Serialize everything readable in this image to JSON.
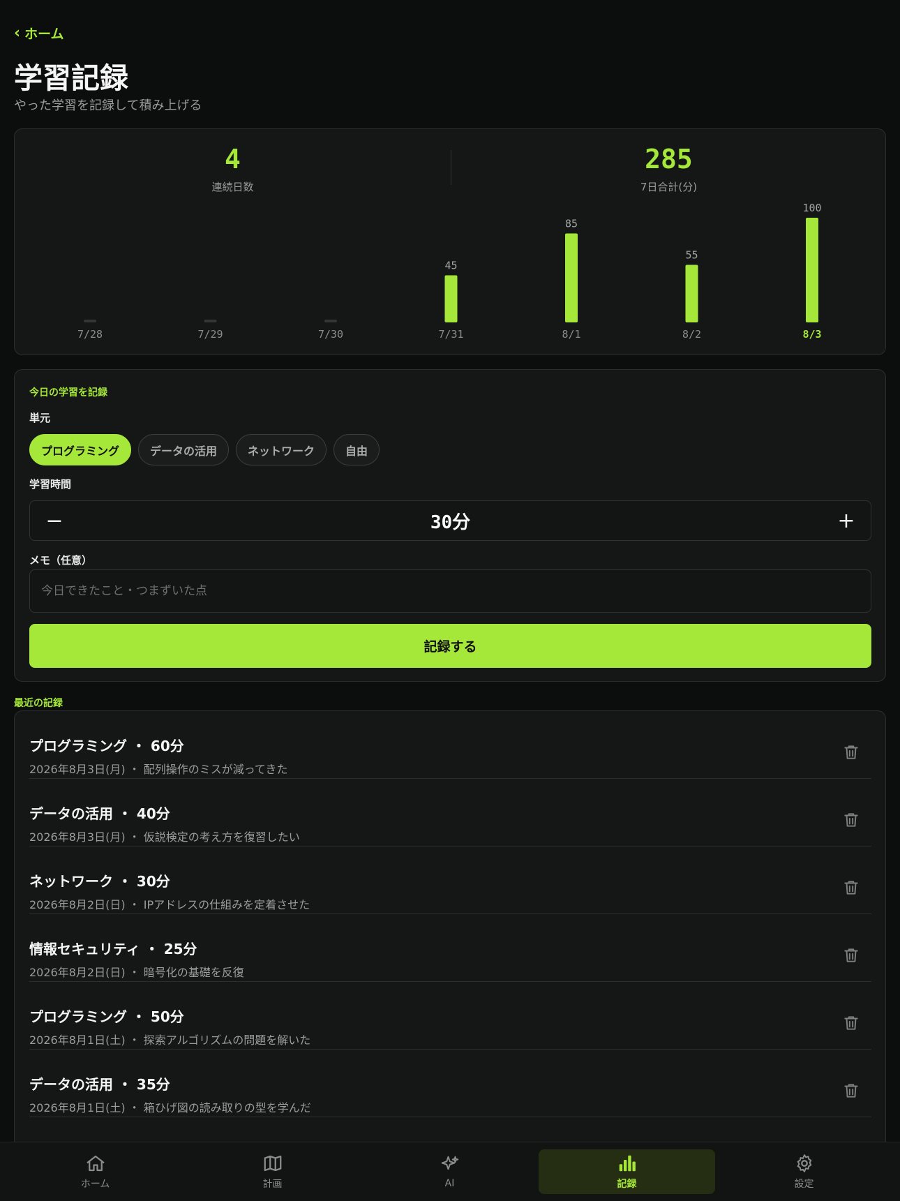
{
  "header": {
    "back_label": "ホーム",
    "title": "学習記録",
    "subtitle": "やった学習を記録して積み上げる"
  },
  "stats": {
    "streak_value": "4",
    "streak_label": "連続日数",
    "total_value": "285",
    "total_label": "7日合計(分)"
  },
  "chart_data": {
    "type": "bar",
    "categories": [
      "7/28",
      "7/29",
      "7/30",
      "7/31",
      "8/1",
      "8/2",
      "8/3"
    ],
    "values": [
      0,
      0,
      0,
      45,
      85,
      55,
      100
    ],
    "highlight_index": 6,
    "ylim": [
      0,
      100
    ],
    "title": "",
    "xlabel": "",
    "ylabel": "",
    "bar_color": "#a6e83a",
    "empty_bar_color": "#333734"
  },
  "form": {
    "section_title": "今日の学習を記録",
    "unit_label": "単元",
    "units": [
      "プログラミング",
      "データの活用",
      "ネットワーク",
      "自由"
    ],
    "selected_unit_index": 0,
    "time_label": "学習時間",
    "minus_label": "−",
    "plus_label": "+",
    "time_value": "30分",
    "memo_label": "メモ（任意）",
    "memo_placeholder": "今日できたこと・つまずいた点",
    "memo_value": "",
    "submit_label": "記録する"
  },
  "recent": {
    "title": "最近の記録",
    "entries": [
      {
        "title": "プログラミング ・ 60分",
        "meta": "2026年8月3日(月) ・ 配列操作のミスが減ってきた"
      },
      {
        "title": "データの活用 ・ 40分",
        "meta": "2026年8月3日(月) ・ 仮説検定の考え方を復習したい"
      },
      {
        "title": "ネットワーク ・ 30分",
        "meta": "2026年8月2日(日) ・ IPアドレスの仕組みを定着させた"
      },
      {
        "title": "情報セキュリティ ・ 25分",
        "meta": "2026年8月2日(日) ・ 暗号化の基礎を反復"
      },
      {
        "title": "プログラミング ・ 50分",
        "meta": "2026年8月1日(土) ・ 探索アルゴリズムの問題を解いた"
      },
      {
        "title": "データの活用 ・ 35分",
        "meta": "2026年8月1日(土) ・ 箱ひげ図の読み取りの型を学んだ"
      }
    ],
    "delete_icon": "trash-icon"
  },
  "tabbar": {
    "tabs": [
      {
        "label": "ホーム",
        "icon": "home-icon"
      },
      {
        "label": "計画",
        "icon": "map-icon"
      },
      {
        "label": "AI",
        "icon": "sparkles-icon"
      },
      {
        "label": "記録",
        "icon": "bar-chart-icon"
      },
      {
        "label": "設定",
        "icon": "gear-icon"
      }
    ],
    "active_index": 3
  },
  "colors": {
    "accent": "#a6e83a",
    "background": "#0c0e0d",
    "card": "#141716"
  }
}
